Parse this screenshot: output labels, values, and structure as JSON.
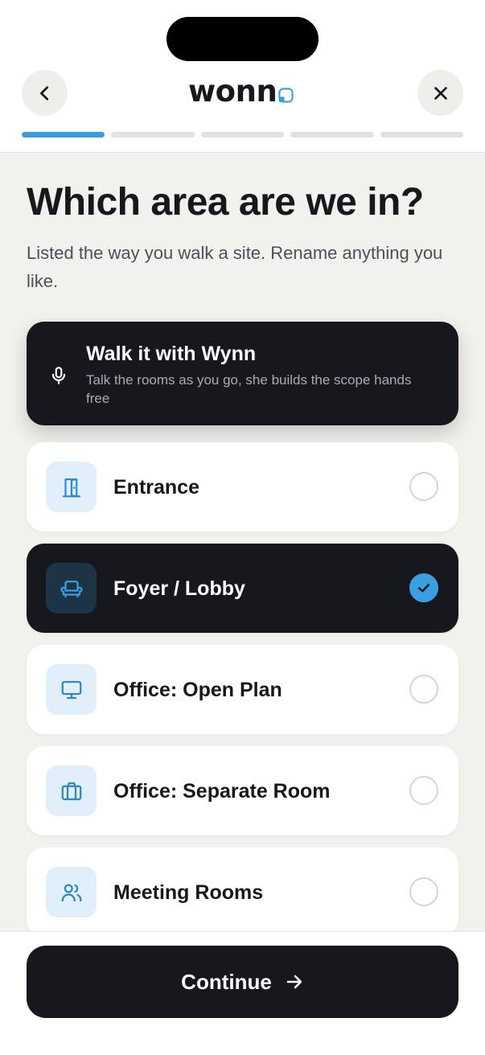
{
  "header": {
    "logo_text": "wonn",
    "brand_color": "#3a9ee0",
    "back_icon": "chevron-left-icon",
    "close_icon": "close-icon",
    "progress": {
      "current_step": 1,
      "total_steps": 5
    }
  },
  "main": {
    "title": "Which area are we in?",
    "subtitle": "Listed the way you walk a site. Rename anything you like."
  },
  "voice_card": {
    "title": "Walk it with Wynn",
    "description": "Talk the rooms as you go, she builds the scope hands free",
    "icon": "microphone-icon"
  },
  "options": [
    {
      "label": "Entrance",
      "icon": "door-icon",
      "selected": false
    },
    {
      "label": "Foyer / Lobby",
      "icon": "armchair-icon",
      "selected": true
    },
    {
      "label": "Office: Open Plan",
      "icon": "monitor-icon",
      "selected": false
    },
    {
      "label": "Office: Separate Room",
      "icon": "briefcase-icon",
      "selected": false
    },
    {
      "label": "Meeting Rooms",
      "icon": "users-icon",
      "selected": false
    }
  ],
  "footer": {
    "continue_label": "Continue",
    "arrow_icon": "arrow-right-icon"
  }
}
